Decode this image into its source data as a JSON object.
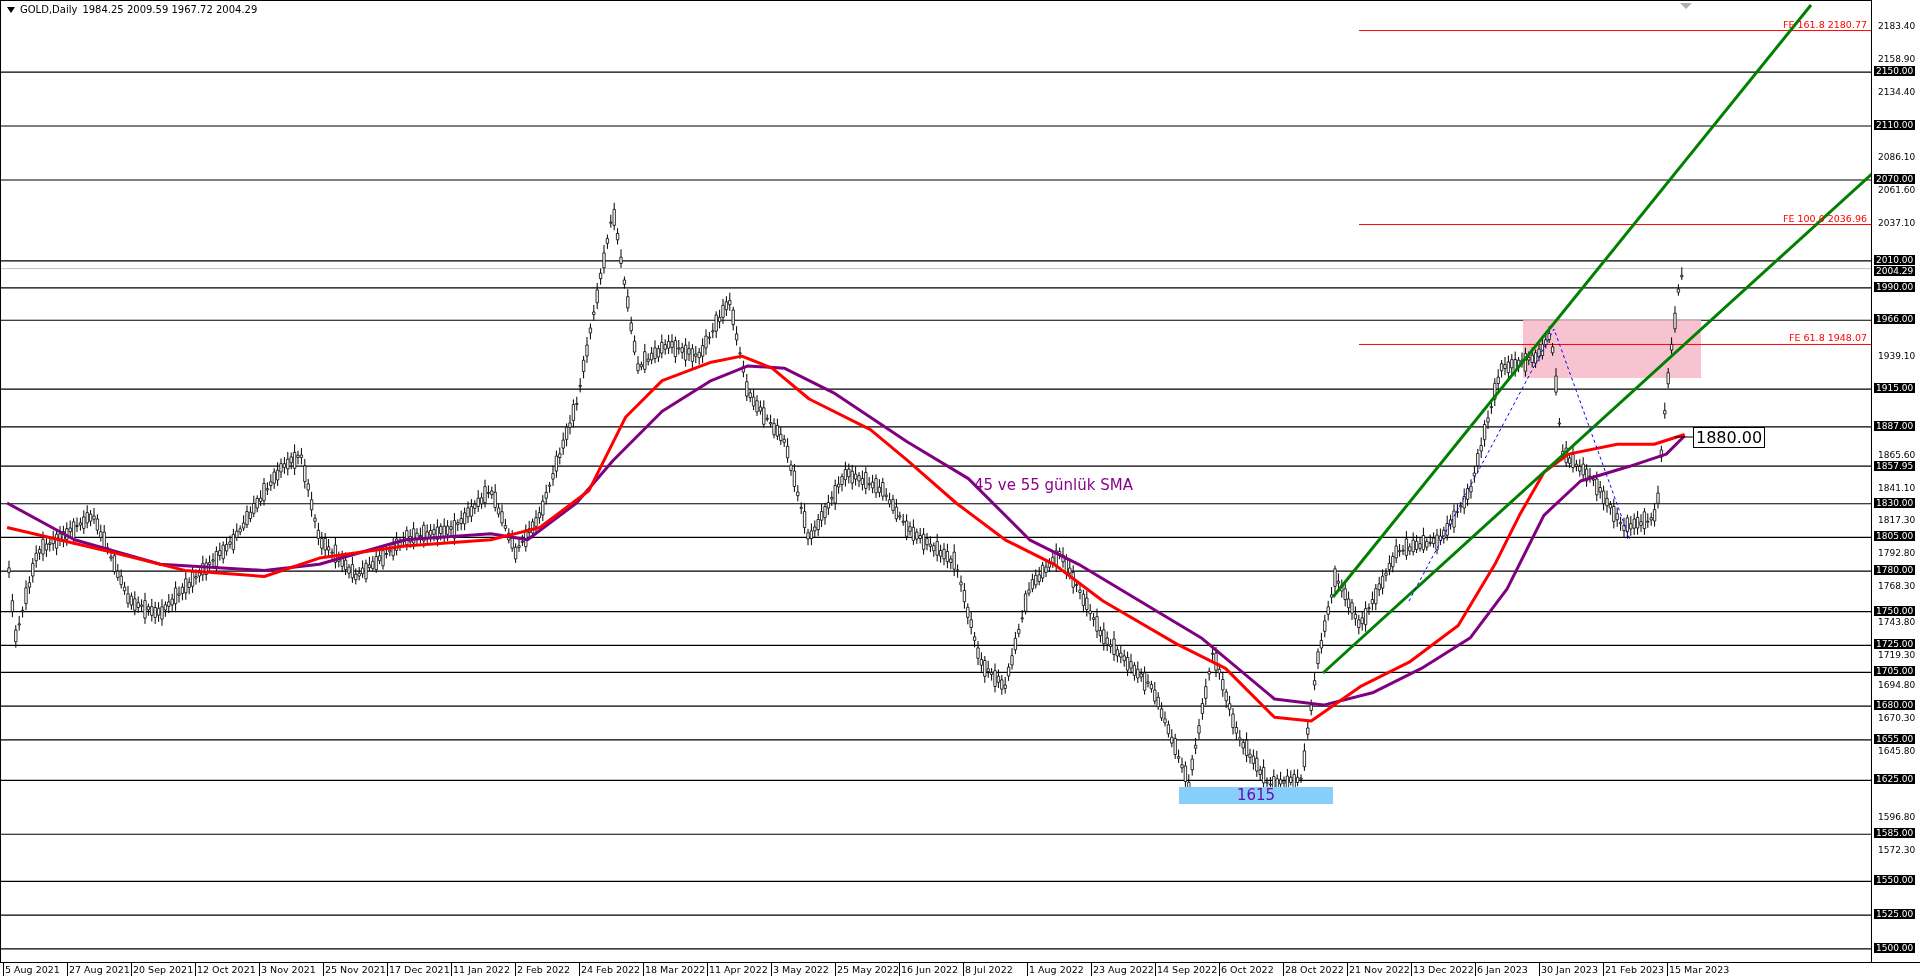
{
  "header": {
    "symbol": "GOLD,Daily",
    "ohlc": "1984.25 2009.59 1967.72 2004.29"
  },
  "annotations": [
    {
      "kind": "sma_note",
      "text": "45 ve 55 günlük SMA"
    },
    {
      "kind": "support_zone",
      "text": "1615"
    },
    {
      "kind": "price_tag",
      "text": "1880.00"
    }
  ],
  "fe_levels": [
    {
      "label": "FE 161.8 2180.77"
    },
    {
      "label": "FE 100.0 2036.96"
    },
    {
      "label": "FE 61.8 1948.07"
    }
  ],
  "price_axis": [
    {
      "label": "2183.40",
      "kind": "tick"
    },
    {
      "label": "2158.90",
      "kind": "tick"
    },
    {
      "label": "2150.00",
      "kind": "level"
    },
    {
      "label": "2134.40",
      "kind": "tick"
    },
    {
      "label": "2110.00",
      "kind": "level"
    },
    {
      "label": "2086.10",
      "kind": "tick"
    },
    {
      "label": "2070.00",
      "kind": "level"
    },
    {
      "label": "2061.60",
      "kind": "tick"
    },
    {
      "label": "2037.10",
      "kind": "tick"
    },
    {
      "label": "2010.00",
      "kind": "level"
    },
    {
      "label": "2004.29",
      "kind": "current"
    },
    {
      "label": "1990.00",
      "kind": "level"
    },
    {
      "label": "1966.00",
      "kind": "level"
    },
    {
      "label": "1939.10",
      "kind": "tick"
    },
    {
      "label": "1915.00",
      "kind": "level"
    },
    {
      "label": "1887.00",
      "kind": "level"
    },
    {
      "label": "1865.60",
      "kind": "tick"
    },
    {
      "label": "1857.95",
      "kind": "level"
    },
    {
      "label": "1841.10",
      "kind": "tick"
    },
    {
      "label": "1830.00",
      "kind": "level"
    },
    {
      "label": "1817.30",
      "kind": "tick"
    },
    {
      "label": "1805.00",
      "kind": "level"
    },
    {
      "label": "1792.80",
      "kind": "tick"
    },
    {
      "label": "1780.00",
      "kind": "level"
    },
    {
      "label": "1768.30",
      "kind": "tick"
    },
    {
      "label": "1750.00",
      "kind": "level"
    },
    {
      "label": "1743.80",
      "kind": "tick"
    },
    {
      "label": "1725.00",
      "kind": "level"
    },
    {
      "label": "1719.30",
      "kind": "tick"
    },
    {
      "label": "1705.00",
      "kind": "level"
    },
    {
      "label": "1694.80",
      "kind": "tick"
    },
    {
      "label": "1680.00",
      "kind": "level"
    },
    {
      "label": "1670.30",
      "kind": "tick"
    },
    {
      "label": "1655.00",
      "kind": "level"
    },
    {
      "label": "1645.80",
      "kind": "tick"
    },
    {
      "label": "1625.00",
      "kind": "level"
    },
    {
      "label": "1596.80",
      "kind": "tick"
    },
    {
      "label": "1585.00",
      "kind": "level"
    },
    {
      "label": "1572.30",
      "kind": "tick"
    },
    {
      "label": "1550.00",
      "kind": "level"
    },
    {
      "label": "1525.00",
      "kind": "level"
    },
    {
      "label": "1500.00",
      "kind": "level"
    }
  ],
  "time_axis": [
    "5 Aug 2021",
    "27 Aug 2021",
    "20 Sep 2021",
    "12 Oct 2021",
    "3 Nov 2021",
    "25 Nov 2021",
    "17 Dec 2021",
    "11 Jan 2022",
    "2 Feb 2022",
    "24 Feb 2022",
    "18 Mar 2022",
    "11 Apr 2022",
    "3 May 2022",
    "25 May 2022",
    "16 Jun 2022",
    "8 Jul 2022",
    "1 Aug 2022",
    "23 Aug 2022",
    "14 Sep 2022",
    "6 Oct 2022",
    "28 Oct 2022",
    "21 Nov 2022",
    "13 Dec 2022",
    "6 Jan 2023",
    "30 Jan 2023",
    "21 Feb 2023",
    "15 Mar 2023"
  ]
}
